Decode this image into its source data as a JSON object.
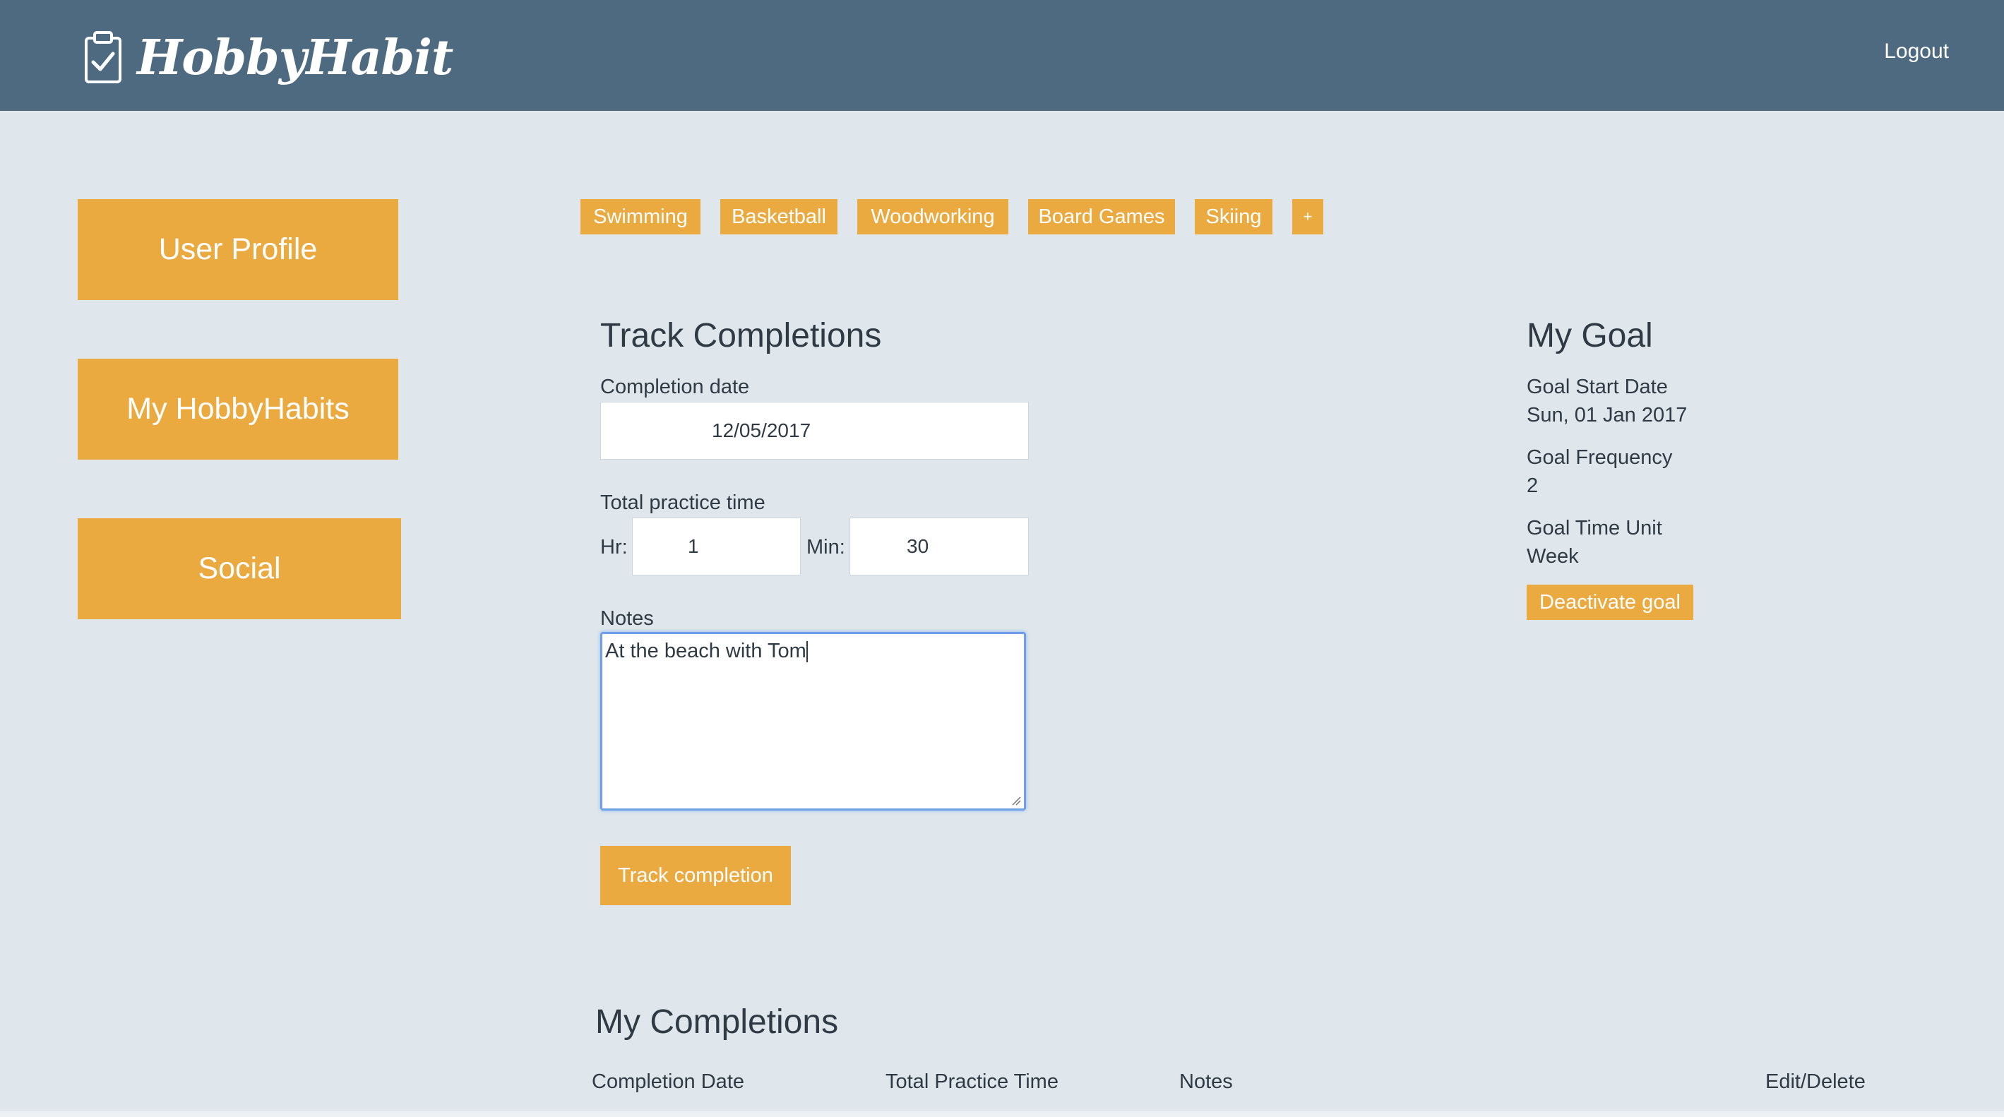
{
  "header": {
    "brand": "HobbyHabit",
    "logout_label": "Logout"
  },
  "sidebar": {
    "items": [
      {
        "label": "User Profile"
      },
      {
        "label": "My HobbyHabits"
      },
      {
        "label": "Social"
      }
    ]
  },
  "hobby_tabs": [
    "Swimming",
    "Basketball",
    "Woodworking",
    "Board Games",
    "Skiing",
    "+"
  ],
  "track": {
    "title": "Track Completions",
    "date_label": "Completion date",
    "date_value": "12/05/2017",
    "practice_label": "Total practice time",
    "hr_label": "Hr:",
    "hr_value": "1",
    "min_label": "Min:",
    "min_value": "30",
    "notes_label": "Notes",
    "notes_value": "At the beach with Tom",
    "submit_label": "Track completion"
  },
  "goal": {
    "title": "My Goal",
    "start_label": "Goal Start Date",
    "start_value": "Sun, 01 Jan 2017",
    "frequency_label": "Goal Frequency",
    "frequency_value": "2",
    "unit_label": "Goal Time Unit",
    "unit_value": "Week",
    "deactivate_label": "Deactivate goal"
  },
  "completions": {
    "title": "My Completions",
    "columns": [
      "Completion Date",
      "Total Practice Time",
      "Notes",
      "Edit/Delete"
    ]
  },
  "colors": {
    "header_bg": "#4e6a80",
    "page_bg": "#e0e7ec",
    "accent": "#ebaa3f"
  }
}
